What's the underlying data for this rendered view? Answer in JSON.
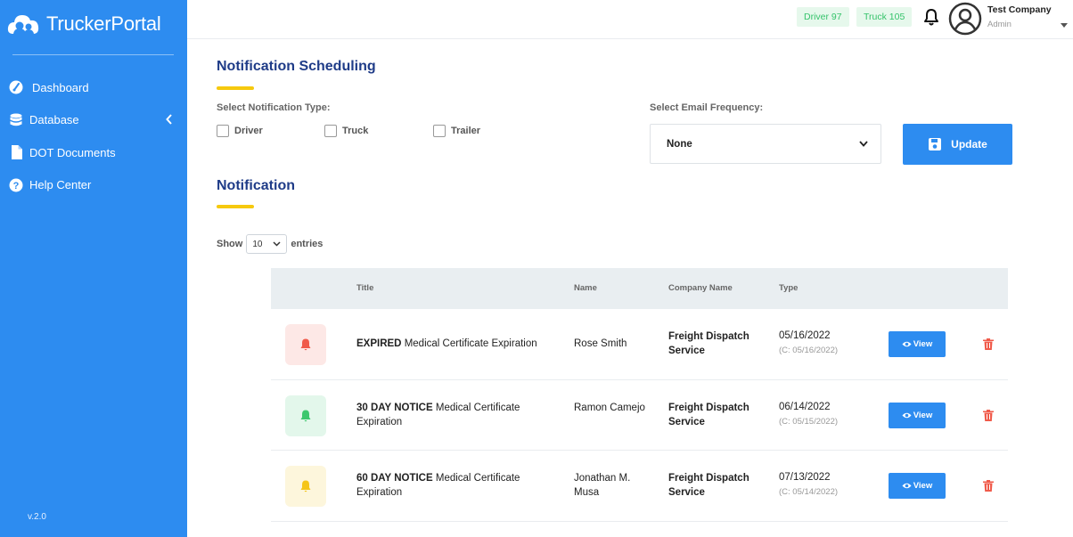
{
  "app": {
    "brand": "TruckerPortal",
    "version": "v.2.0"
  },
  "sidebar": {
    "items": [
      {
        "label": "Dashboard",
        "icon": "dashboard-gauge-icon"
      },
      {
        "label": "Database",
        "icon": "database-icon"
      },
      {
        "label": "DOT Documents",
        "icon": "document-icon"
      },
      {
        "label": "Help Center",
        "icon": "help-icon"
      }
    ]
  },
  "header": {
    "driver_chip": "Driver 97",
    "truck_chip": "Truck 105",
    "company": "Test Company",
    "role": "Admin"
  },
  "scheduling": {
    "title": "Notification Scheduling",
    "type_label": "Select Notification Type:",
    "options": [
      "Driver",
      "Truck",
      "Trailer"
    ],
    "frequency_label": "Select Email Frequency:",
    "frequency_value": "None",
    "update_label": "Update"
  },
  "notification": {
    "title": "Notification",
    "show_label": "Show",
    "entries_value": "10",
    "entries_label": "entries",
    "columns": [
      "Title",
      "Name",
      "Company Name",
      "Type"
    ],
    "rows": [
      {
        "status": "expired",
        "prefix": "EXPIRED",
        "title": "Medical Certificate Expiration",
        "name": "Rose Smith",
        "company": "Freight Dispatch Service",
        "date": "05/16/2022",
        "created": "(C: 05/16/2022)",
        "view_label": "View"
      },
      {
        "status": "30day",
        "prefix": "30 DAY NOTICE",
        "title": "Medical Certificate Expiration",
        "name": "Ramon Camejo",
        "company": "Freight Dispatch Service",
        "date": "06/14/2022",
        "created": "(C: 05/15/2022)",
        "view_label": "View"
      },
      {
        "status": "60day",
        "prefix": "60 DAY NOTICE",
        "title": "Medical Certificate Expiration",
        "name": "Jonathan M. Musa",
        "company": "Freight Dispatch Service",
        "date": "07/13/2022",
        "created": "(C: 05/14/2022)",
        "view_label": "View"
      }
    ]
  },
  "colors": {
    "primary": "#2d8cf0",
    "title_blue": "#1f3c88",
    "accent_yellow": "#f6c90e",
    "chip_green": "#35c36b",
    "expired_red": "#f05a4a",
    "notice_green": "#3cc86d",
    "notice_yellow": "#f5c518"
  }
}
